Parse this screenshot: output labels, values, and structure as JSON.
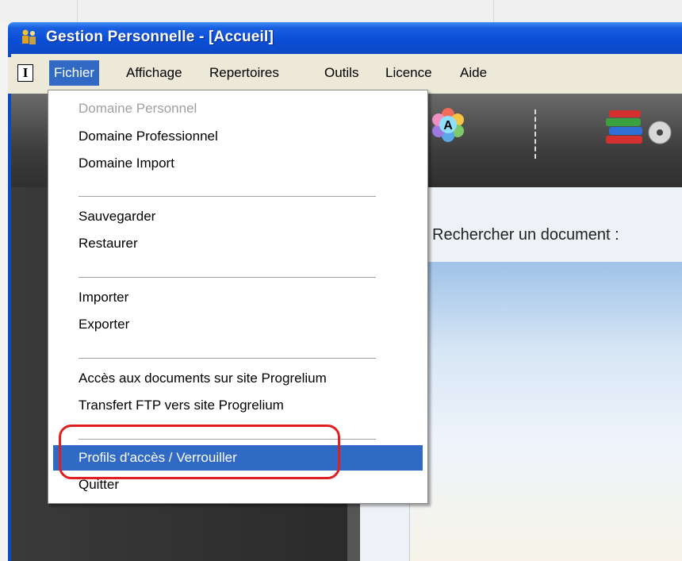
{
  "window": {
    "title": "Gestion Personnelle - [Accueil]"
  },
  "menubar": {
    "system_glyph": "I",
    "items": [
      "Fichier",
      "Affichage",
      "Repertoires",
      "Outils",
      "Licence",
      "Aide"
    ],
    "active_index": 0
  },
  "fichier_menu": {
    "groups": [
      [
        "Domaine Personnel",
        "Domaine Professionnel",
        "Domaine Import"
      ],
      [
        "Sauvegarder",
        "Restaurer"
      ],
      [
        "Importer",
        "Exporter"
      ],
      [
        "Accès aux documents sur site Progrelium",
        "Transfert FTP vers site Progrelium"
      ],
      [
        "Profils d'accès / Verrouiller",
        "Quitter"
      ]
    ],
    "disabled_item": "Domaine Personnel",
    "highlighted_item": "Profils d'accès / Verrouiller"
  },
  "main": {
    "search_label": "Rechercher un document :"
  },
  "icons": {
    "app": "app-icon",
    "toolbar": [
      "palette-a-icon",
      "books-cd-icon"
    ]
  },
  "colors": {
    "titlebar": "#0d49c7",
    "menu_highlight": "#316ac5",
    "annotation": "#e02020"
  }
}
